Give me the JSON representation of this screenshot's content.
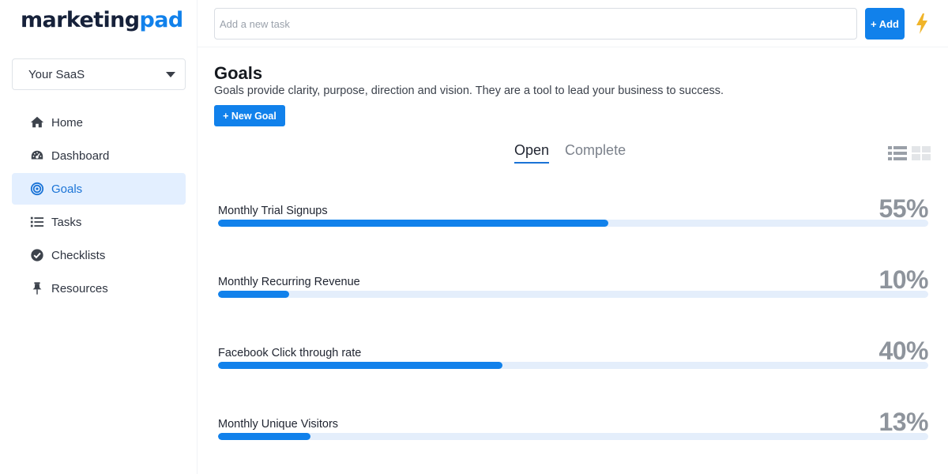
{
  "brand": {
    "part1": "marketing",
    "part2": "pad"
  },
  "workspace": {
    "selected": "Your SaaS"
  },
  "nav": {
    "items": [
      {
        "label": "Home",
        "icon": "home-icon",
        "active": false
      },
      {
        "label": "Dashboard",
        "icon": "dashboard-icon",
        "active": false
      },
      {
        "label": "Goals",
        "icon": "target-icon",
        "active": true
      },
      {
        "label": "Tasks",
        "icon": "list-icon",
        "active": false
      },
      {
        "label": "Checklists",
        "icon": "check-circle-icon",
        "active": false
      },
      {
        "label": "Resources",
        "icon": "pin-icon",
        "active": false
      }
    ]
  },
  "topbar": {
    "task_placeholder": "Add a new task",
    "add_label": "+ Add",
    "bolt_icon": "lightning-icon"
  },
  "main": {
    "title": "Goals",
    "description": "Goals  provide clarity, purpose, direction and vision. They are a tool to lead your business to success.",
    "new_goal_label": "+ New Goal",
    "tabs": [
      {
        "label": "Open",
        "active": true
      },
      {
        "label": "Complete",
        "active": false
      }
    ],
    "view_toggle": {
      "list_icon": "list-view-icon",
      "grid_icon": "grid-view-icon",
      "active": "list"
    }
  },
  "goals": [
    {
      "name": "Monthly Trial Signups",
      "percent_label": "55%",
      "progress": 55
    },
    {
      "name": "Monthly Recurring Revenue",
      "percent_label": "10%",
      "progress": 10
    },
    {
      "name": "Facebook Click through rate",
      "percent_label": "40%",
      "progress": 40
    },
    {
      "name": "Monthly Unique Visitors",
      "percent_label": "13%",
      "progress": 13
    }
  ],
  "colors": {
    "accent": "#1181eb",
    "brand_dark": "#16213a",
    "active_nav_bg": "#e3efff",
    "track": "#e4eefb",
    "percent_text": "#8e949c",
    "bolt": "#f0b429"
  }
}
